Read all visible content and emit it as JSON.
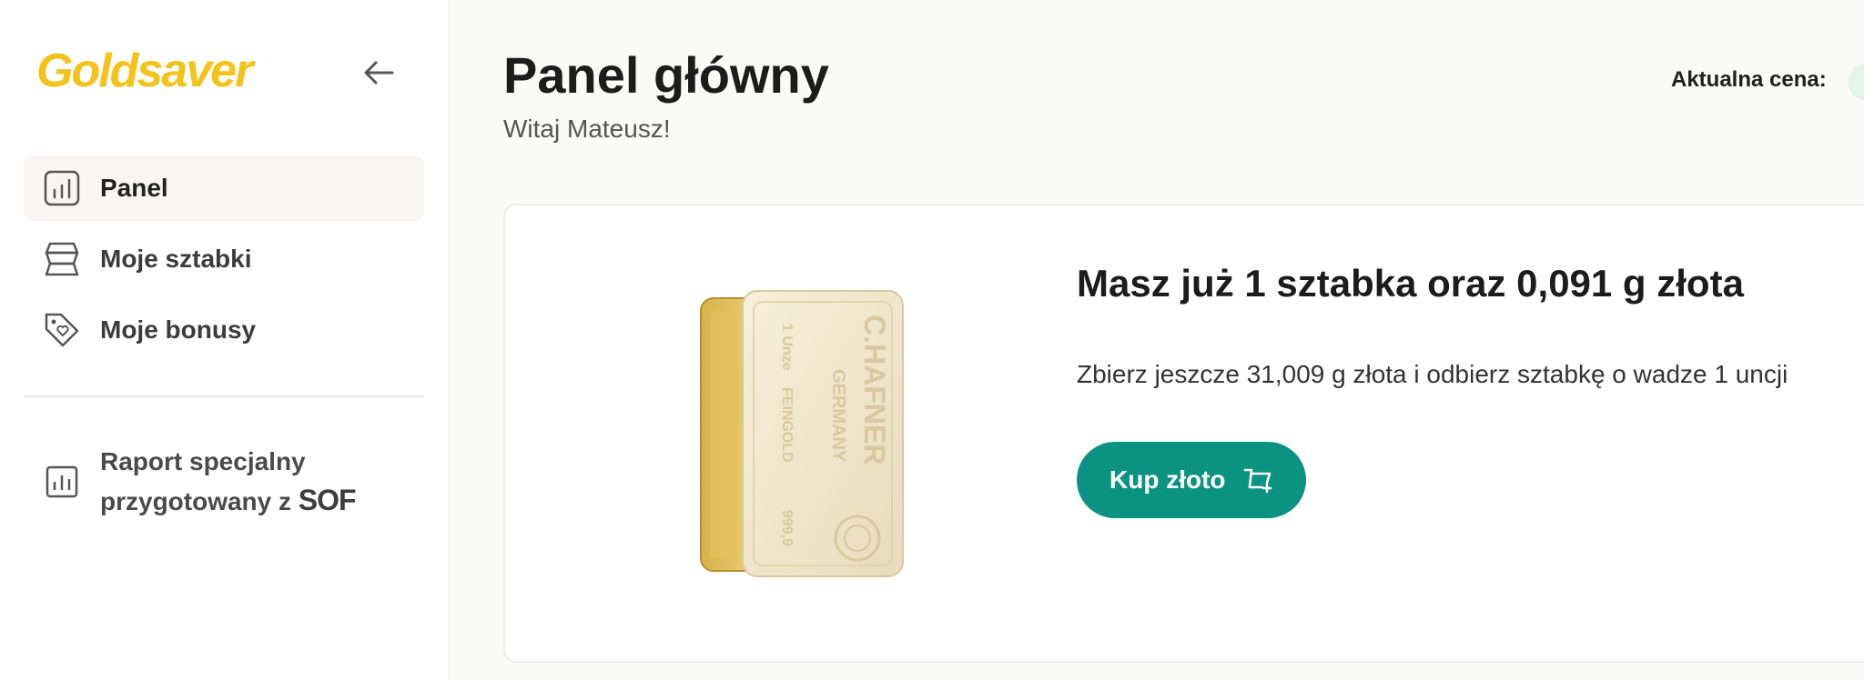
{
  "sidebar": {
    "logo": "Goldsaver",
    "collapse_icon": "arrow-left-icon",
    "items": [
      {
        "label": "Panel",
        "icon": "bar-chart-icon",
        "active": true
      },
      {
        "label": "Moje sztabki",
        "icon": "gold-bars-stack-icon",
        "active": false
      },
      {
        "label": "Moje bonusy",
        "icon": "tag-heart-icon",
        "active": false
      }
    ],
    "report": {
      "label_line1": "Raport specjalny",
      "label_line2": "przygotowany z",
      "partner_logo": "SOF",
      "icon": "report-chart-icon"
    }
  },
  "header": {
    "title": "Panel główny",
    "subtitle": "Witaj Mateusz!",
    "price_label": "Aktualna cena:"
  },
  "card": {
    "heading": "Masz już 1 sztabka oraz 0,091 g złota",
    "text": "Zbierz jeszcze 31,009 g złota i odbierz sztabkę o wadze 1 uncji",
    "button_label": "Kup złoto",
    "button_icon": "cart-plus-icon",
    "image": {
      "bar_brand": "C.HAFNER",
      "bar_origin": "GERMANY",
      "bar_weight": "1 Unze",
      "bar_text": "FEINGOLD",
      "bar_purity": "999,9"
    }
  },
  "colors": {
    "brand_gold": "#f3c31b",
    "button_teal": "#0b9381",
    "active_nav_bg": "#f7f6f4"
  }
}
